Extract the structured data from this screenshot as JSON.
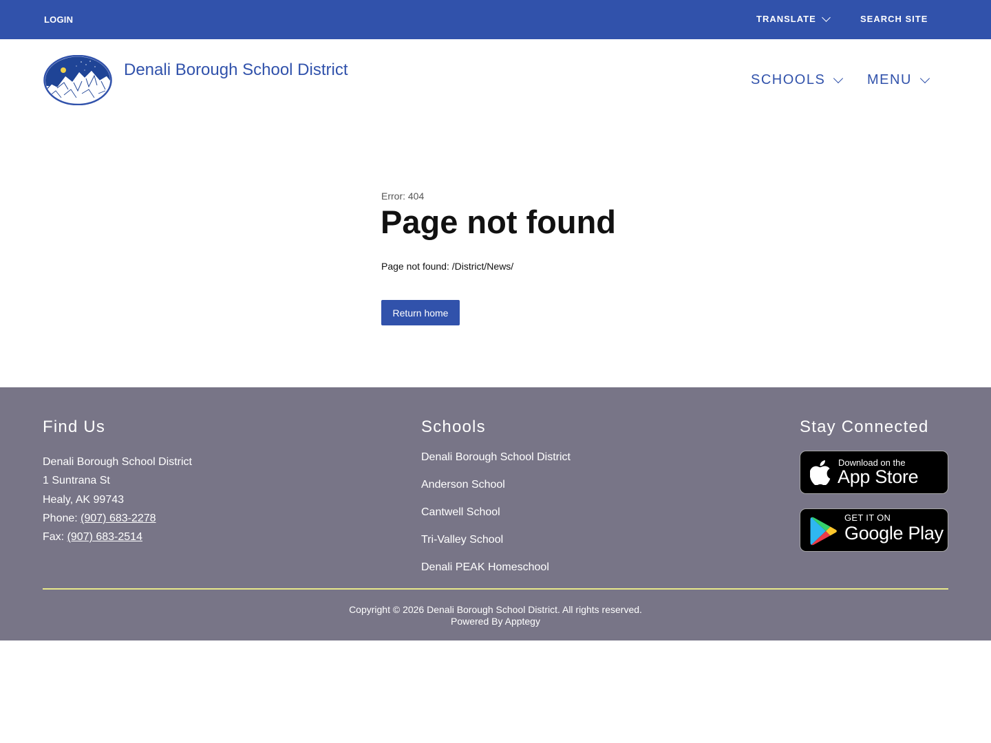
{
  "topbar": {
    "login": "LOGIN",
    "translate": "TRANSLATE",
    "search": "SEARCH SITE"
  },
  "header": {
    "site_title": "Denali Borough School District",
    "nav": {
      "schools": "SCHOOLS",
      "menu": "MENU"
    }
  },
  "main": {
    "error_code": "Error: 404",
    "title": "Page not found",
    "message": "Page not found: /District/News/",
    "return_button": "Return home"
  },
  "footer": {
    "find_us": {
      "heading": "Find Us",
      "name": "Denali Borough School District",
      "street": "1 Suntrana St",
      "city": "Healy, AK 99743",
      "phone_label": "Phone: ",
      "phone": "(907) 683-2278",
      "fax_label": "Fax: ",
      "fax": "(907) 683-2514"
    },
    "schools": {
      "heading": "Schools",
      "items": [
        "Denali Borough School District",
        "Anderson School",
        "Cantwell School",
        "Tri-Valley School",
        "Denali PEAK Homeschool"
      ]
    },
    "stay_connected": {
      "heading": "Stay Connected",
      "app_store": {
        "small": "Download on the",
        "big": "App Store"
      },
      "google_play": {
        "small": "GET IT ON",
        "big": "Google Play"
      }
    },
    "copyright": "Copyright © 2026 Denali Borough School District. All rights reserved.",
    "powered_by": "Powered By Apptegy"
  },
  "colors": {
    "brand_blue": "#3152ab",
    "footer_gray": "#787587",
    "divider_yellow": "#e9e98a"
  }
}
